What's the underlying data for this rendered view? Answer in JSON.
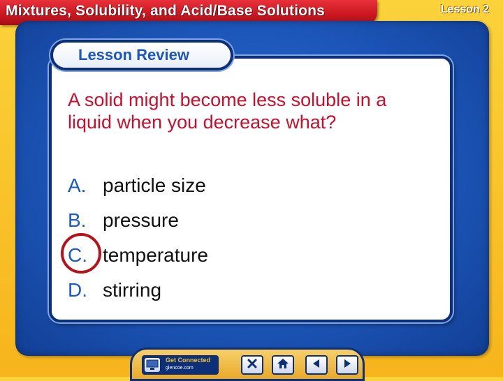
{
  "header": {
    "title": "Mixtures, Solubility, and Acid/Base Solutions",
    "lesson": "Lesson 2"
  },
  "panel": {
    "tab_label": "Lesson Review",
    "question": "A solid might become less soluble in a liquid when you decrease what?",
    "answers": [
      {
        "letter": "A.",
        "text": "particle size"
      },
      {
        "letter": "B.",
        "text": "pressure"
      },
      {
        "letter": "C.",
        "text": "temperature"
      },
      {
        "letter": "D.",
        "text": "stirring"
      }
    ],
    "correct_answer": "C."
  },
  "nav": {
    "get_connected_label": "Get Connected",
    "get_connected_url": "glencoe.com",
    "buttons": [
      "close-icon",
      "home-icon",
      "previous-icon",
      "next-icon"
    ]
  },
  "colors": {
    "title_red": "#c8161f",
    "frame_blue": "#1c56b8",
    "question_red": "#c8102e",
    "letter_blue": "#1d58c8",
    "background_gold": "#f7b41c"
  }
}
